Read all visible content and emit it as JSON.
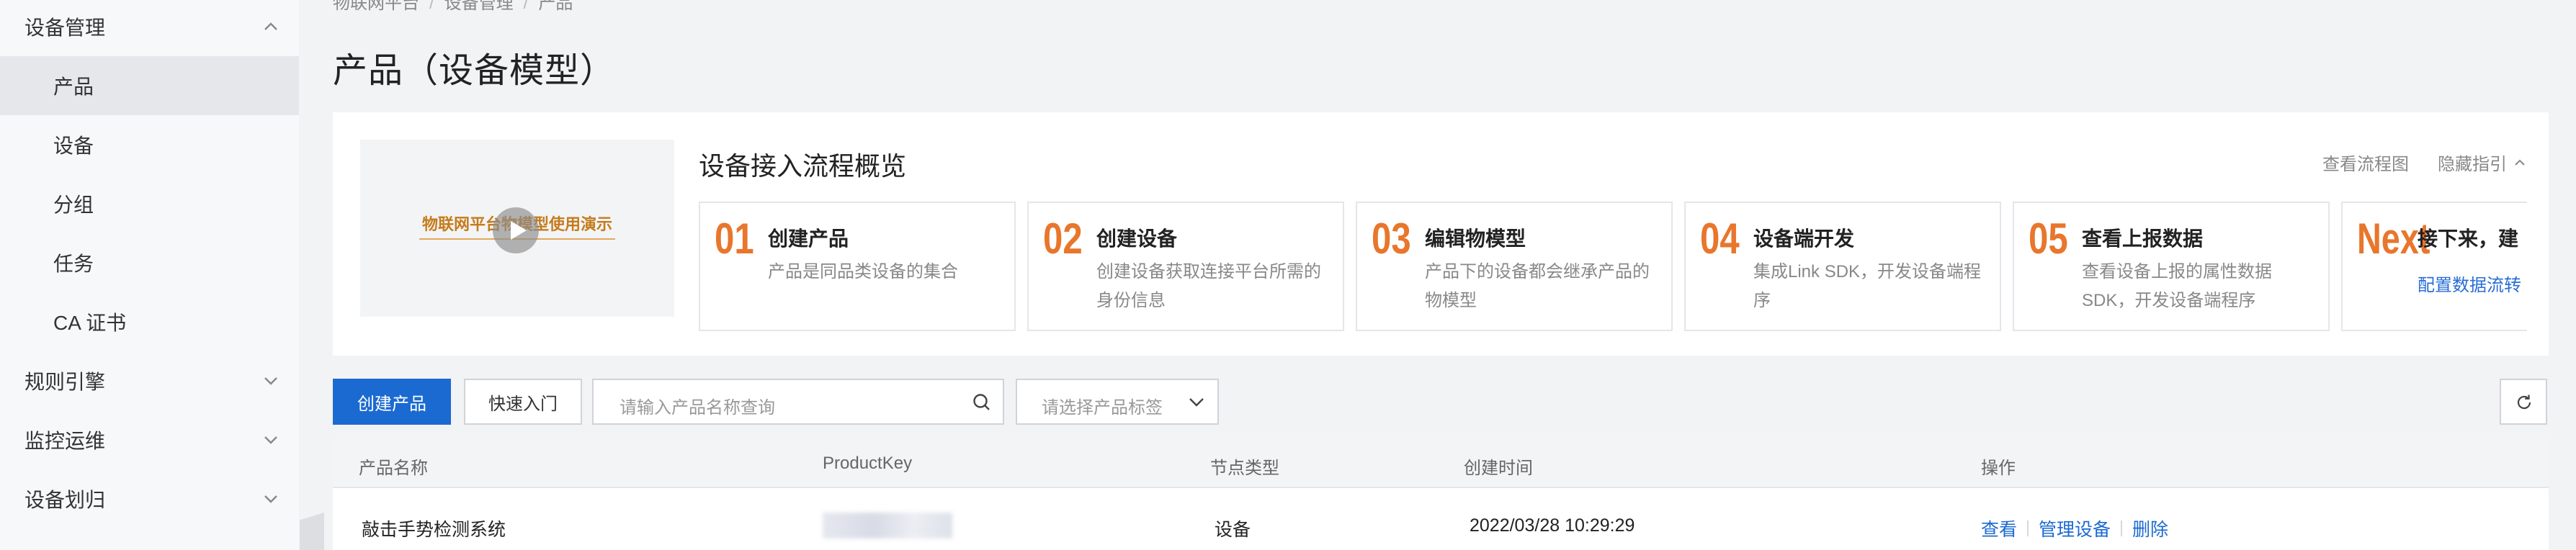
{
  "sidebar": {
    "items": [
      {
        "label": "设备管理",
        "type": "group",
        "expanded": true
      },
      {
        "label": "产品",
        "type": "sub",
        "active": true
      },
      {
        "label": "设备",
        "type": "sub"
      },
      {
        "label": "分组",
        "type": "sub"
      },
      {
        "label": "任务",
        "type": "sub"
      },
      {
        "label": "CA 证书",
        "type": "sub"
      },
      {
        "label": "规则引擎",
        "type": "group",
        "expanded": false
      },
      {
        "label": "监控运维",
        "type": "group",
        "expanded": false
      },
      {
        "label": "设备划归",
        "type": "group",
        "expanded": false
      }
    ]
  },
  "breadcrumb": [
    "物联网平台",
    "设备管理",
    "产品"
  ],
  "page": {
    "title": "产品（设备模型）"
  },
  "guide": {
    "video_title": "物联网平台物模型使用演示",
    "title": "设备接入流程概览",
    "link_view_flow": "查看流程图",
    "link_hide": "隐藏指引",
    "steps": [
      {
        "num": "01",
        "title": "创建产品",
        "desc": "产品是同品类设备的集合"
      },
      {
        "num": "02",
        "title": "创建设备",
        "desc": "创建设备获取连接平台所需的身份信息"
      },
      {
        "num": "03",
        "title": "编辑物模型",
        "desc": "产品下的设备都会继承产品的物模型"
      },
      {
        "num": "04",
        "title": "设备端开发",
        "desc": "集成Link SDK，开发设备端程序"
      },
      {
        "num": "05",
        "title": "查看上报数据",
        "desc": "查看设备上报的属性数据SDK，开发设备端程序"
      },
      {
        "num": "Next",
        "title": "接下来，建",
        "link": "配置数据流转"
      }
    ]
  },
  "toolbar": {
    "create_label": "创建产品",
    "quickstart_label": "快速入门",
    "search_placeholder": "请输入产品名称查询",
    "tag_placeholder": "请选择产品标签"
  },
  "table": {
    "columns": [
      "产品名称",
      "ProductKey",
      "节点类型",
      "创建时间",
      "操作"
    ],
    "rows": [
      {
        "name": "敲击手势检测系统",
        "node_type": "设备",
        "created": "2022/03/28 10:29:29",
        "actions": [
          "查看",
          "管理设备",
          "删除"
        ]
      }
    ]
  },
  "colors": {
    "primary": "#1b6ad1",
    "step_number": "#e8762c",
    "video_title": "#c57b1b"
  }
}
